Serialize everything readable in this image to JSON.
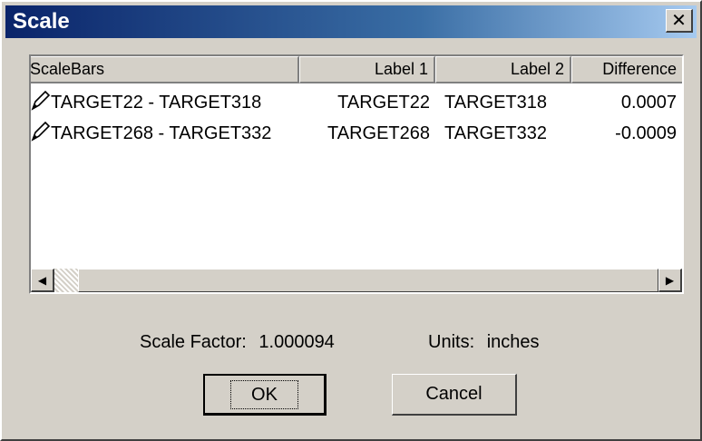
{
  "window": {
    "title": "Scale"
  },
  "list": {
    "headers": [
      "ScaleBars",
      "Label 1",
      "Label 2",
      "Difference"
    ],
    "rows": [
      {
        "name": "TARGET22 - TARGET318",
        "label1": "TARGET22",
        "label2": "TARGET318",
        "diff": "0.0007"
      },
      {
        "name": "TARGET268 - TARGET332",
        "label1": "TARGET268",
        "label2": "TARGET332",
        "diff": "-0.0009"
      }
    ]
  },
  "info": {
    "scale_label": "Scale Factor:",
    "scale_value": "1.000094",
    "units_label": "Units:",
    "units_value": "inches"
  },
  "buttons": {
    "ok": "OK",
    "cancel": "Cancel"
  },
  "icons": {
    "close": "close-icon",
    "row": "pencil-icon",
    "scroll_left": "arrow-left-icon",
    "scroll_right": "arrow-right-icon"
  }
}
